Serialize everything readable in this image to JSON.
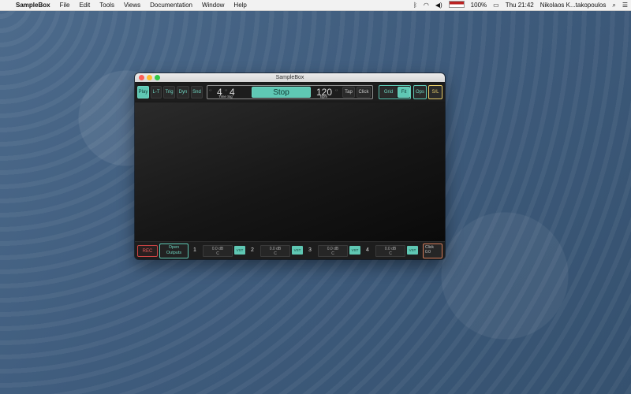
{
  "menubar": {
    "app_name": "SampleBox",
    "items": [
      "File",
      "Edit",
      "Tools",
      "Views",
      "Documentation",
      "Window",
      "Help"
    ],
    "battery": "100%",
    "time": "Thu 21:42",
    "user": "Nikolaos K...takopoulos"
  },
  "window": {
    "title": "SampleBox"
  },
  "toolbar": {
    "modes": [
      "Play",
      "L-T",
      "Trig",
      "Dyn",
      "Snd"
    ],
    "active_mode": "Play",
    "time_sig_top": "4",
    "time_sig_bottom": "4",
    "time_sig_label": "Time Sig",
    "transport_label": "Stop",
    "bpm_value": "120",
    "bpm_label": "Bpm",
    "tap_label": "Tap",
    "click_label": "Click",
    "grid_label": "Grid",
    "fit_label": "Fit",
    "ops_label": "Ops",
    "sl_label": "S/L"
  },
  "bottom": {
    "rec_label": "REC",
    "open_outputs_line1": "Open",
    "open_outputs_line2": "Outputs",
    "channels": [
      {
        "num": "1",
        "db": "0.0 dB",
        "pan": "C",
        "vst": "VST"
      },
      {
        "num": "2",
        "db": "0.0 dB",
        "pan": "C",
        "vst": "VST"
      },
      {
        "num": "3",
        "db": "0.0 dB",
        "pan": "C",
        "vst": "VST"
      },
      {
        "num": "4",
        "db": "0.0 dB",
        "pan": "C",
        "vst": "VST"
      }
    ],
    "click_title": "Click",
    "click_value": "0.0"
  },
  "colors": {
    "accent": "#5fc8b4",
    "rec": "#e45a5a",
    "click_border": "#d27b5a"
  }
}
